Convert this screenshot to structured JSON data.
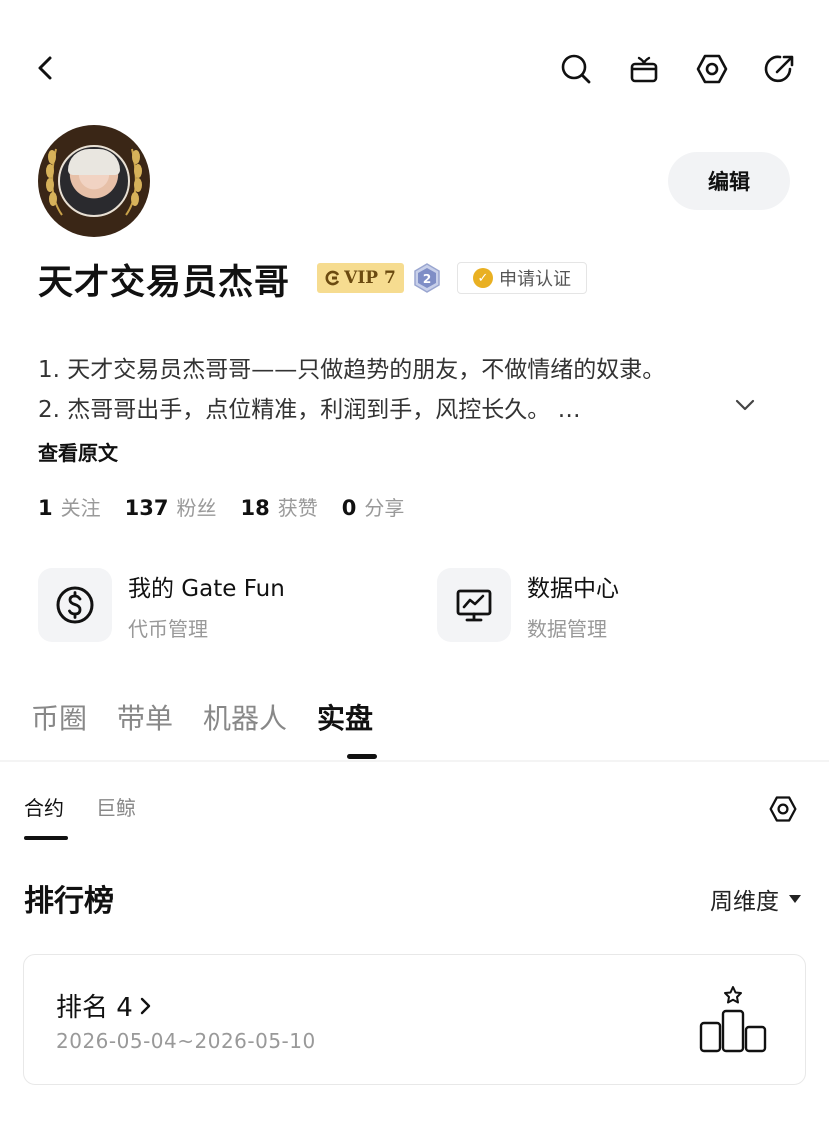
{
  "header": {
    "back_icon": "chevron-left-icon",
    "actions": [
      "search-icon",
      "gift-icon",
      "settings-icon",
      "share-icon"
    ]
  },
  "profile": {
    "edit_label": "编辑",
    "name": "天才交易员杰哥",
    "vip_badge": "VIP 7",
    "level_badge": "2",
    "certify_label": "申请认证",
    "bio_line1": "1. 天才交易员杰哥哥——只做趋势的朋友，不做情绪的奴隶。",
    "bio_line2": "2. 杰哥哥出手，点位精准，利润到手，风控长久。 …",
    "view_original": "查看原文"
  },
  "stats": [
    {
      "num": "1",
      "label": "关注"
    },
    {
      "num": "137",
      "label": "粉丝"
    },
    {
      "num": "18",
      "label": "获赞"
    },
    {
      "num": "0",
      "label": "分享"
    }
  ],
  "tools": [
    {
      "title": "我的 Gate Fun",
      "subtitle": "代币管理",
      "icon": "dollar-icon"
    },
    {
      "title": "数据中心",
      "subtitle": "数据管理",
      "icon": "monitor-chart-icon"
    }
  ],
  "main_tabs": [
    "币圈",
    "带单",
    "机器人",
    "实盘"
  ],
  "main_tab_active": "实盘",
  "sub_tabs": [
    "合约",
    "巨鲸"
  ],
  "sub_tab_active": "合约",
  "ranking": {
    "title": "排行榜",
    "period": "周维度",
    "rank_label": "排名 4",
    "date_range": "2026-05-04~2026-05-10"
  },
  "colors": {
    "vip_bg": "#f6dc90",
    "vip_text": "#6b4a10",
    "muted": "#999999",
    "chip_bg": "#f3f4f6"
  }
}
